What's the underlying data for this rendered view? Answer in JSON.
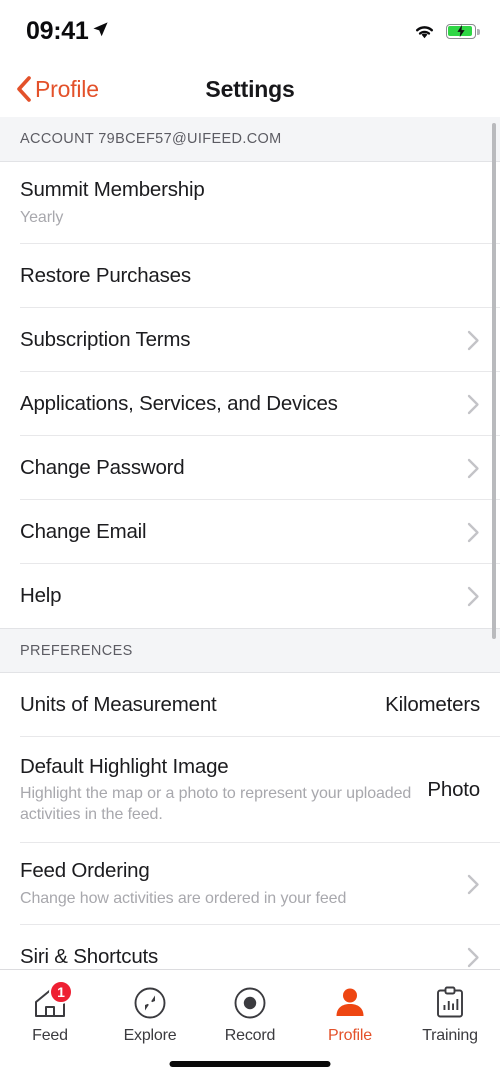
{
  "status_bar": {
    "time": "09:41",
    "location_icon": "location-arrow-icon",
    "wifi_icon": "wifi-icon",
    "battery_icon": "battery-charging-icon",
    "battery_charging": true
  },
  "nav": {
    "back_label": "Profile",
    "back_icon": "chevron-left-icon",
    "title": "Settings"
  },
  "theme": {
    "accent": "#e3512a",
    "badge_red": "#ee1f32",
    "battery_green": "#2fd645",
    "section_bg": "#f4f5f7",
    "separator": "#e8e8ea"
  },
  "sections": [
    {
      "header": "ACCOUNT 79BCEF57@UIFEED.COM",
      "rows": [
        {
          "title": "Summit Membership",
          "subtitle": "Yearly",
          "value": "",
          "chevron": false
        },
        {
          "title": "Restore Purchases",
          "subtitle": "",
          "value": "",
          "chevron": false
        },
        {
          "title": "Subscription Terms",
          "subtitle": "",
          "value": "",
          "chevron": true
        },
        {
          "title": "Applications, Services, and Devices",
          "subtitle": "",
          "value": "",
          "chevron": true
        },
        {
          "title": "Change Password",
          "subtitle": "",
          "value": "",
          "chevron": true
        },
        {
          "title": "Change Email",
          "subtitle": "",
          "value": "",
          "chevron": true
        },
        {
          "title": "Help",
          "subtitle": "",
          "value": "",
          "chevron": true
        }
      ]
    },
    {
      "header": "PREFERENCES",
      "rows": [
        {
          "title": "Units of Measurement",
          "subtitle": "",
          "value": "Kilometers",
          "chevron": false
        },
        {
          "title": "Default Highlight Image",
          "subtitle": "Highlight the map or a photo to represent your uploaded activities in the feed.",
          "value": "Photo",
          "chevron": false
        },
        {
          "title": "Feed Ordering",
          "subtitle": "Change how activities are ordered in your feed",
          "value": "",
          "chevron": true
        },
        {
          "title": "Siri & Shortcuts",
          "subtitle": "",
          "value": "",
          "chevron": true
        }
      ]
    }
  ],
  "tabbar": {
    "items": [
      {
        "label": "Feed",
        "icon": "home-icon",
        "active": false,
        "badge": "1"
      },
      {
        "label": "Explore",
        "icon": "compass-icon",
        "active": false,
        "badge": ""
      },
      {
        "label": "Record",
        "icon": "record-dot-icon",
        "active": false,
        "badge": ""
      },
      {
        "label": "Profile",
        "icon": "person-icon",
        "active": true,
        "badge": ""
      },
      {
        "label": "Training",
        "icon": "clipboard-chart-icon",
        "active": false,
        "badge": ""
      }
    ]
  }
}
